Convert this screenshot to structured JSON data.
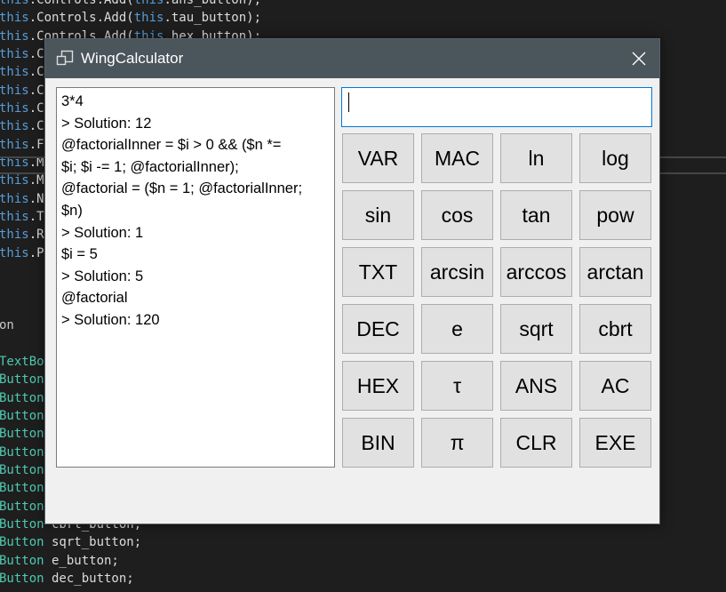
{
  "background_code": [
    "this.Controls.Add(this.ans_button);",
    "this.Controls.Add(this.tau_button);",
    "this.Controls.Add(this.hex_button);",
    "this.C",
    "this.C",
    "this.C",
    "this.C",
    "this.C",
    "this.F",
    "this.M",
    "this.M",
    "this.N",
    "this.T",
    "this.R",
    "this.P",
    "",
    "",
    "",
    "on",
    "",
    "TextBo",
    "Button",
    "Button",
    "Button",
    "Button",
    "Button",
    "Button",
    "Button",
    "Button",
    "Button cbrt_button;",
    "Button sqrt_button;",
    "Button e_button;",
    "Button dec_button;"
  ],
  "window": {
    "title": "WingCalculator",
    "icon": "window-restore-icon",
    "close_icon": "close-icon",
    "titlebar_color": "#4b555c"
  },
  "output": {
    "lines": [
      "3*4",
      "> Solution: 12",
      "@factorialInner = $i > 0 && ($n *=",
      "$i; $i -= 1; @factorialInner);",
      "@factorial = ($n = 1; @factorialInner;",
      "$n)",
      "> Solution: 1",
      "$i = 5",
      "> Solution: 5",
      "@factorial",
      "> Solution: 120"
    ]
  },
  "input": {
    "value": ""
  },
  "buttons": [
    [
      "VAR",
      "MAC",
      "ln",
      "log"
    ],
    [
      "sin",
      "cos",
      "tan",
      "pow"
    ],
    [
      "TXT",
      "arcsin",
      "arccos",
      "arctan"
    ],
    [
      "DEC",
      "e",
      "sqrt",
      "cbrt"
    ],
    [
      "HEX",
      "τ",
      "ANS",
      "AC"
    ],
    [
      "BIN",
      "π",
      "CLR",
      "EXE"
    ]
  ]
}
